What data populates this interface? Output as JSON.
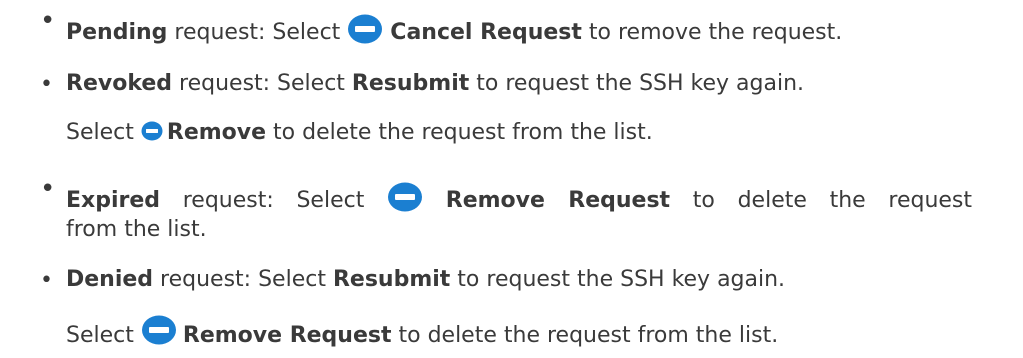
{
  "icons": {
    "remove": "minus-circle-icon",
    "color": "#1b7fd1"
  },
  "bullet_char": "•",
  "items": [
    {
      "strong": "Pending",
      "pre": " request: Select ",
      "action": "Cancel Request",
      "post": " to remove the request."
    },
    {
      "strong": "Revoked",
      "pre": " request: Select ",
      "action": "Resubmit",
      "post": " to request the SSH key again.",
      "cont_pre": "Select ",
      "cont_action": "Remove",
      "cont_post": " to delete the request from the list."
    },
    {
      "strong": "Expired",
      "pre": " request: Select ",
      "action": "Remove Request",
      "post": " to delete the request",
      "wrap": "from the list."
    },
    {
      "strong": "Denied",
      "pre": " request: Select ",
      "action": "Resubmit",
      "post": " to request the SSH key again.",
      "cont_pre": "Select ",
      "cont_action": "Remove Request",
      "cont_post": " to delete the request from the list."
    }
  ]
}
